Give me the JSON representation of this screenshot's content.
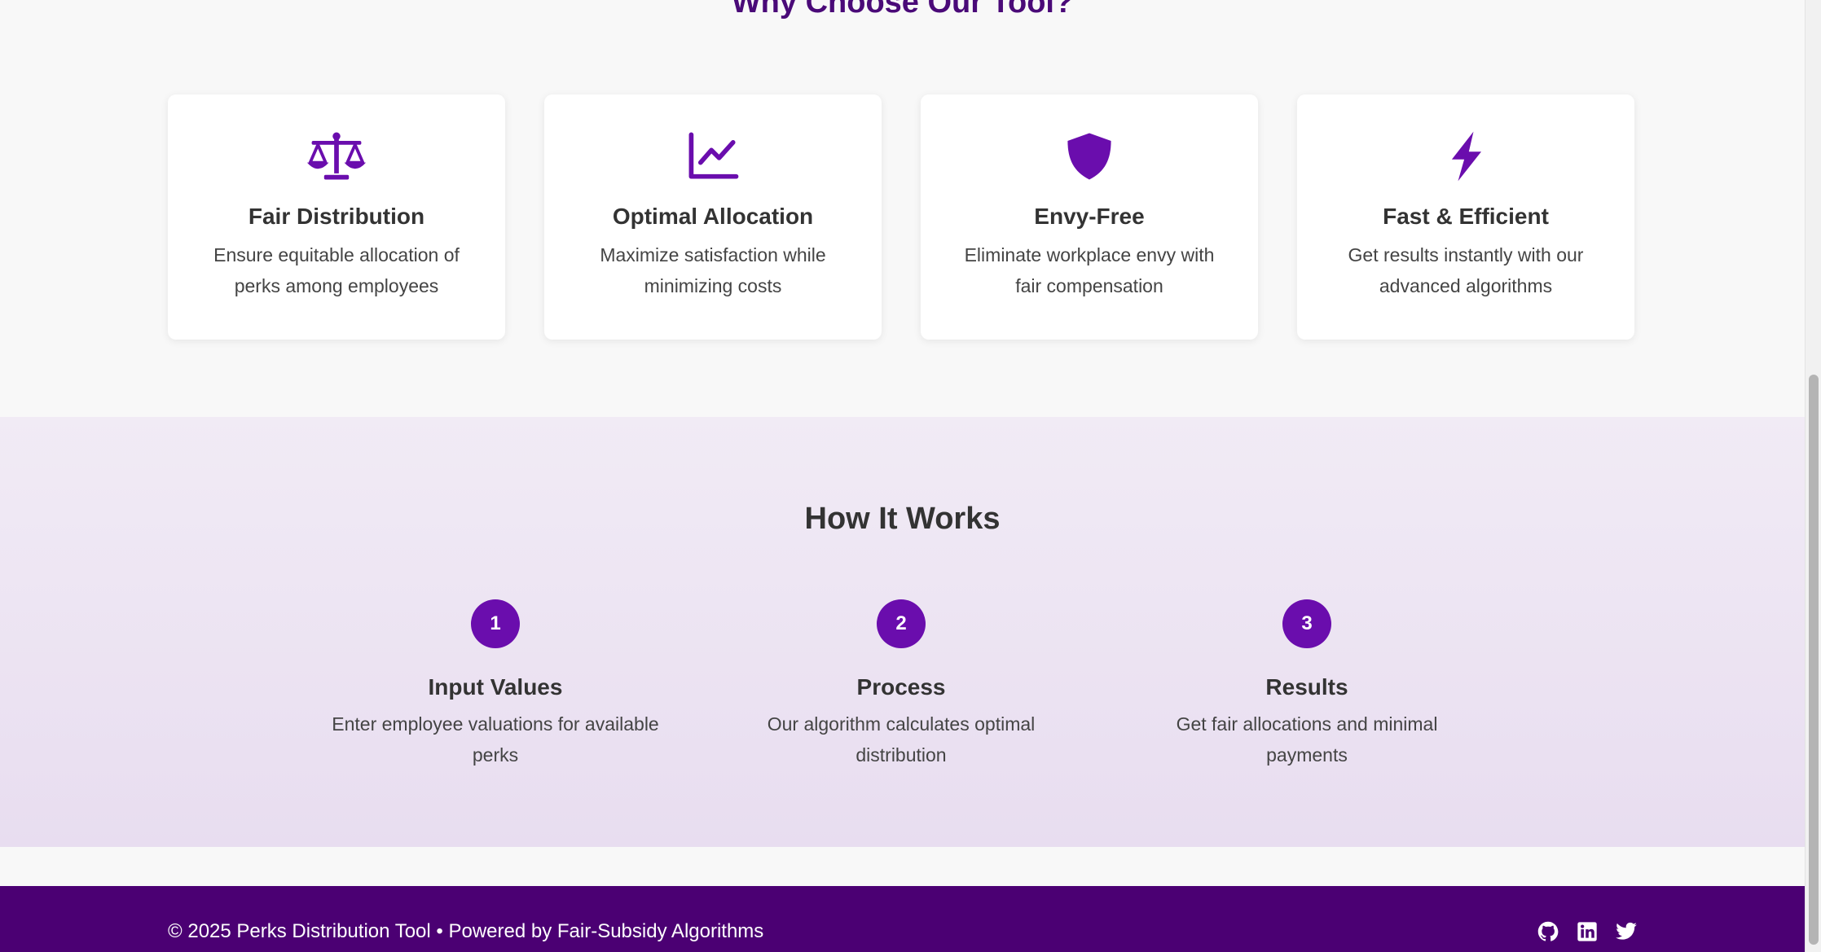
{
  "features": {
    "title": "Why Choose Our Tool?",
    "cards": [
      {
        "icon": "balance-scale-icon",
        "title": "Fair Distribution",
        "description": "Ensure equitable allocation of perks among employees"
      },
      {
        "icon": "chart-line-icon",
        "title": "Optimal Allocation",
        "description": "Maximize satisfaction while minimizing costs"
      },
      {
        "icon": "shield-icon",
        "title": "Envy-Free",
        "description": "Eliminate workplace envy with fair compensation"
      },
      {
        "icon": "lightning-bolt-icon",
        "title": "Fast & Efficient",
        "description": "Get results instantly with our advanced algorithms"
      }
    ]
  },
  "how_it_works": {
    "title": "How It Works",
    "steps": [
      {
        "number": "1",
        "title": "Input Values",
        "description": "Enter employee valuations for available perks"
      },
      {
        "number": "2",
        "title": "Process",
        "description": "Our algorithm calculates optimal distribution"
      },
      {
        "number": "3",
        "title": "Results",
        "description": "Get fair allocations and minimal payments"
      }
    ]
  },
  "footer": {
    "text": "© 2025 Perks Distribution Tool • Powered by Fair-Subsidy Algorithms",
    "social": [
      {
        "icon": "github-icon"
      },
      {
        "icon": "linkedin-icon"
      },
      {
        "icon": "twitter-icon"
      }
    ]
  },
  "colors": {
    "accent": "#6a0dad",
    "title_purple": "#4a0a78",
    "footer_bg": "#4b0073",
    "section_bg": "#ede3f3",
    "page_bg": "#f8f8f8"
  }
}
